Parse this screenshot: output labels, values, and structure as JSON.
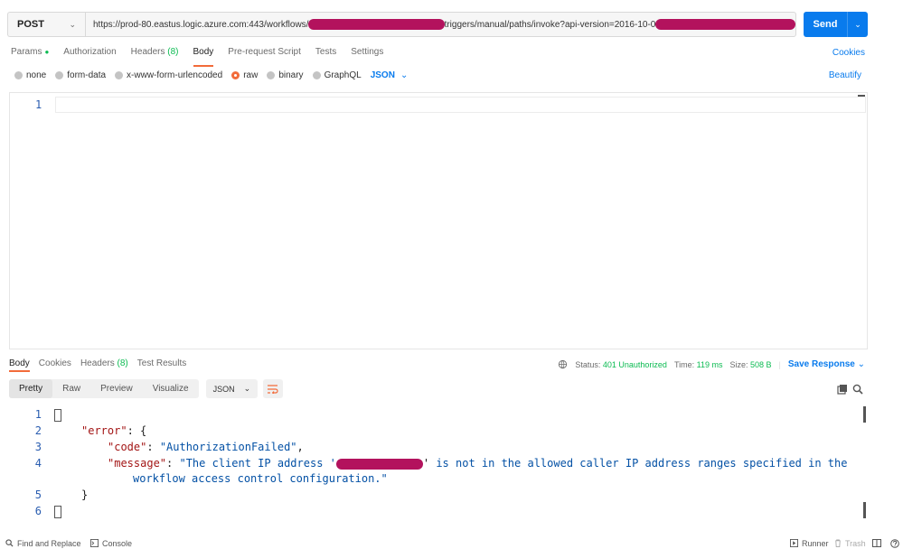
{
  "request": {
    "method": "POST",
    "url_prefix": "https://prod-80.eastus.logic.azure.com:443/workflows/",
    "url_middle": "triggers/manual/paths/invoke?api-version=2016-10-0",
    "send_label": "Send"
  },
  "req_tabs": {
    "params": "Params",
    "authorization": "Authorization",
    "headers": "Headers",
    "headers_count": "(8)",
    "body": "Body",
    "prerequest": "Pre-request Script",
    "tests": "Tests",
    "settings": "Settings",
    "cookies": "Cookies"
  },
  "body_types": {
    "none": "none",
    "form_data": "form-data",
    "urlencoded": "x-www-form-urlencoded",
    "raw": "raw",
    "binary": "binary",
    "graphql": "GraphQL",
    "json": "JSON",
    "beautify": "Beautify"
  },
  "editor": {
    "line": "1"
  },
  "resp_tabs": {
    "body": "Body",
    "cookies": "Cookies",
    "headers": "Headers",
    "headers_count": "(8)",
    "test_results": "Test Results"
  },
  "resp_meta": {
    "status_label": "Status:",
    "status_value": "401 Unauthorized",
    "time_label": "Time:",
    "time_value": "119 ms",
    "size_label": "Size:",
    "size_value": "508 B",
    "save_response": "Save Response"
  },
  "format": {
    "pretty": "Pretty",
    "raw": "Raw",
    "preview": "Preview",
    "visualize": "Visualize",
    "json": "JSON"
  },
  "response_code": {
    "l1": "1",
    "l2": "2",
    "l3": "3",
    "l4": "4",
    "l5": "5",
    "l6": "6",
    "error_key": "\"error\"",
    "code_key": "\"code\"",
    "code_val": "\"AuthorizationFailed\"",
    "message_key": "\"message\"",
    "message_start": "\"The client IP address '",
    "message_rest": "is not in the allowed caller IP address ranges specified in the",
    "message_wrap": "workflow access control configuration.\""
  },
  "statusbar": {
    "find_replace": "Find and Replace",
    "console": "Console",
    "runner": "Runner",
    "trash": "Trash"
  },
  "colors": {
    "accent": "#097bed",
    "tab_underline": "#f26b3a",
    "status_ok": "#0cbb52",
    "redaction": "#b3125d"
  }
}
